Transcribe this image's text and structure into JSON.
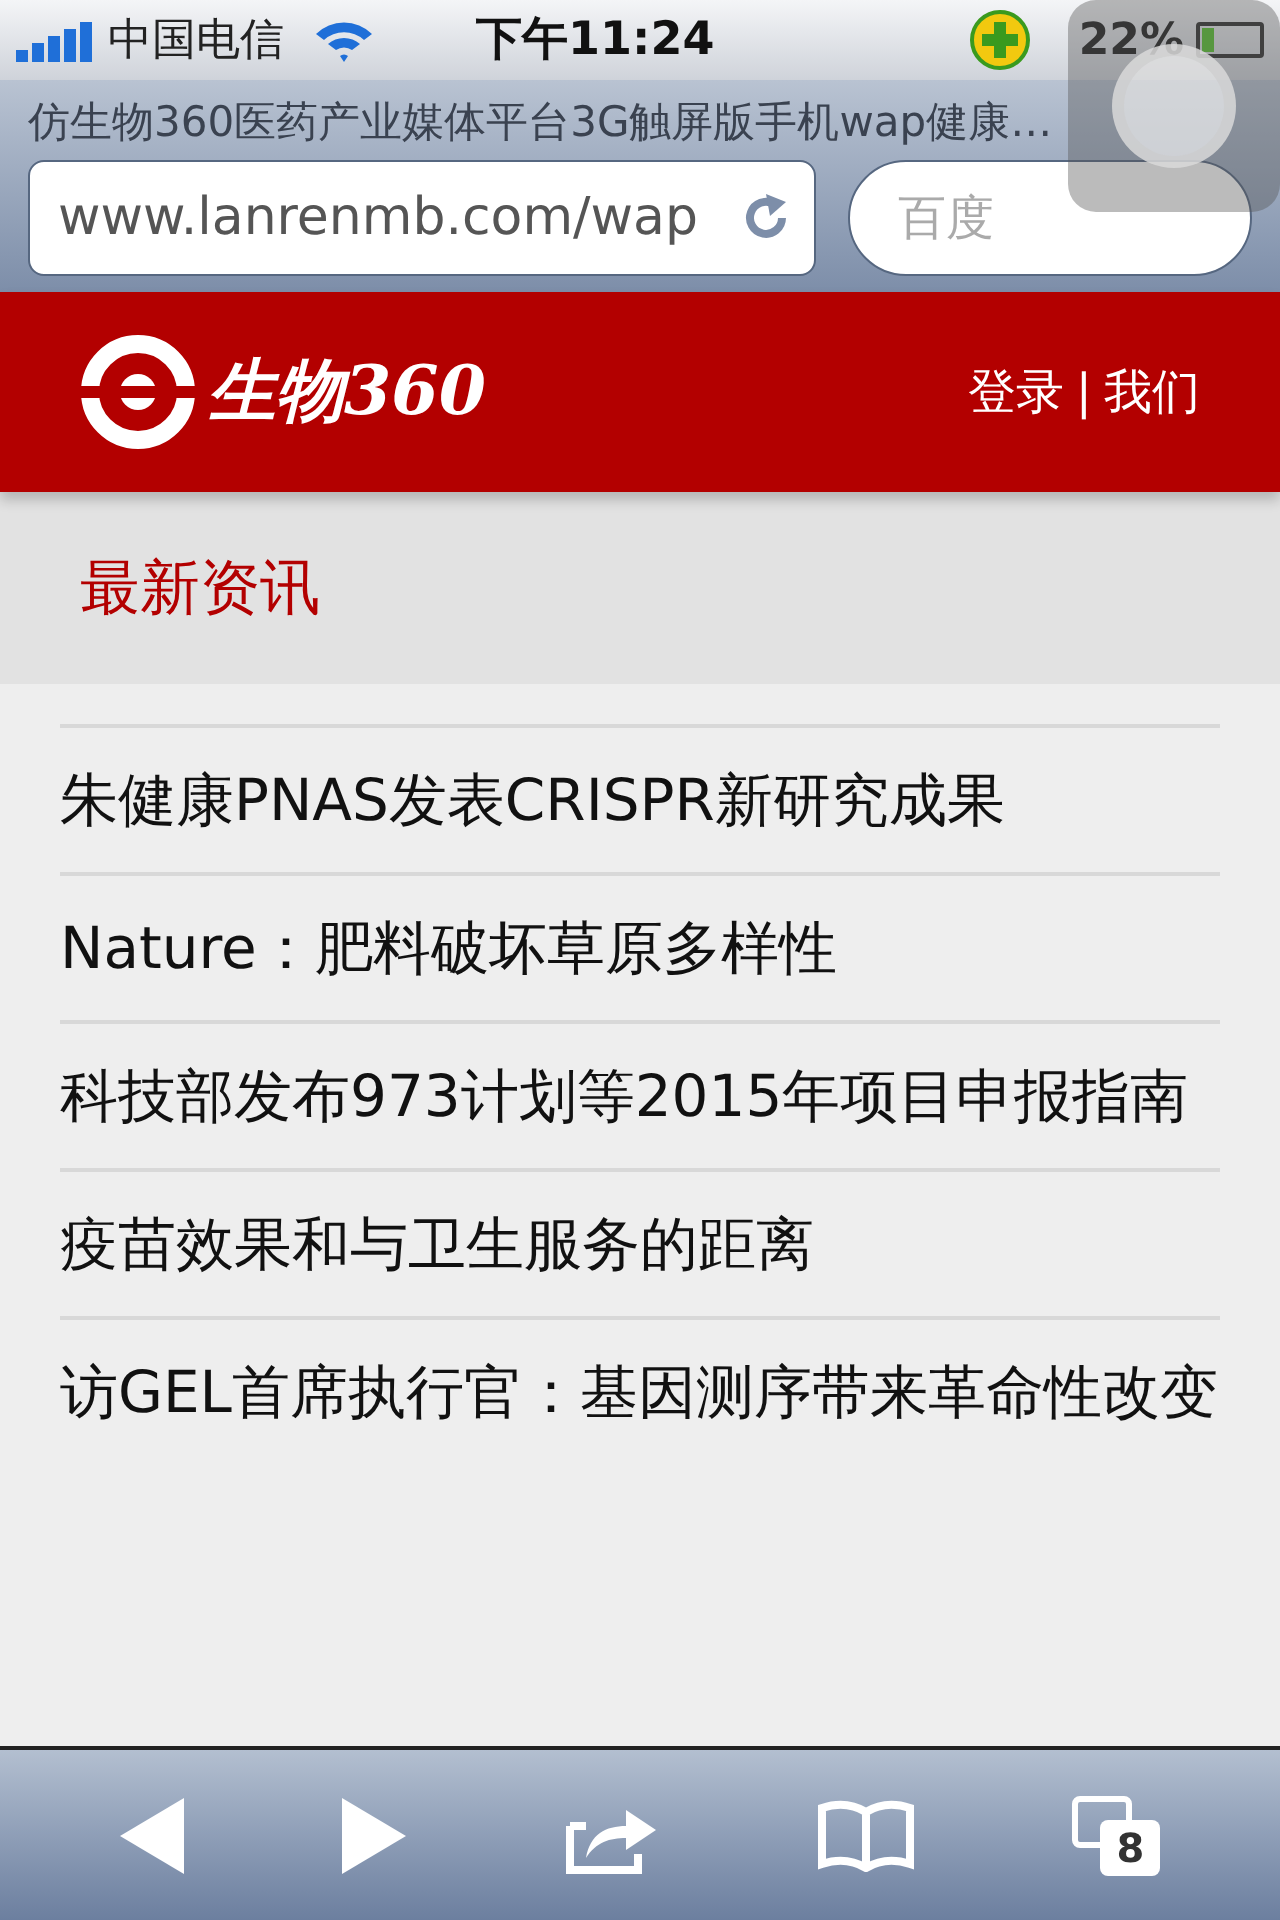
{
  "status_bar": {
    "carrier": "中国电信",
    "time": "下午11:24",
    "battery": "22%"
  },
  "browser": {
    "page_title": "仿生物360医药产业媒体平台3G触屏版手机wap健康…",
    "url": "www.lanrenmb.com/wap",
    "search": {
      "placeholder": "百度"
    }
  },
  "header": {
    "logo_text": "生物360",
    "links": [
      "登录",
      "我们"
    ],
    "separator": "|"
  },
  "section": {
    "title": "最新资讯"
  },
  "news": [
    {
      "title": "朱健康PNAS发表CRISPR新研究成果"
    },
    {
      "title": "Nature：肥料破坏草原多样性"
    },
    {
      "title": "科技部发布973计划等2015年项目申报指南"
    },
    {
      "title": "疫苗效果和与卫生服务的距离"
    },
    {
      "title": "访GEL首席执行官：基因测序带来革命性改变"
    }
  ],
  "toolbar": {
    "tab_count": "8"
  }
}
